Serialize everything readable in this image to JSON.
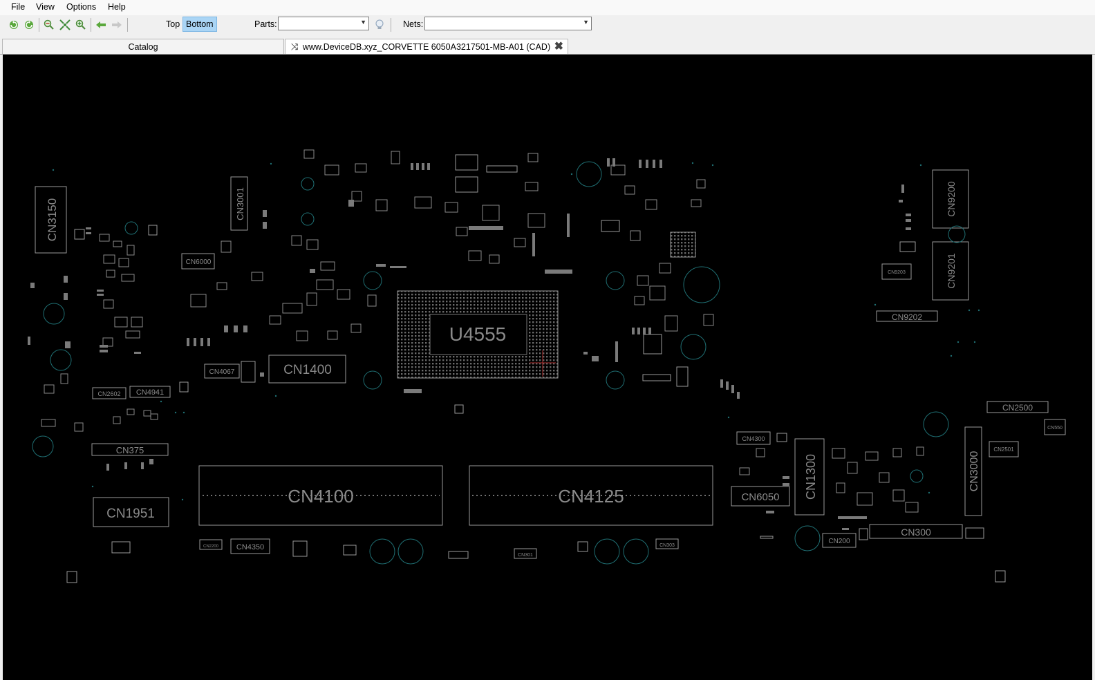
{
  "menubar": {
    "file": "File",
    "view": "View",
    "options": "Options",
    "help": "Help"
  },
  "toolbar": {
    "top_label": "Top",
    "bottom_label": "Bottom",
    "parts_label": "Parts:",
    "parts_value": "",
    "nets_label": "Nets:",
    "nets_value": "",
    "icons": [
      "rotate-left-icon",
      "rotate-right-icon",
      "zoom-out-icon",
      "fit-icon",
      "zoom-in-icon",
      "back-icon",
      "forward-icon",
      "bulb-icon"
    ]
  },
  "tabs": {
    "catalog": "Catalog",
    "cad": "www.DeviceDB.xyz_CORVETTE 6050A3217501-MB-A01 (CAD)"
  },
  "board": {
    "components": {
      "cn3150": "CN3150",
      "cn3001": "CN3001",
      "cn6000": "CN6000",
      "cn1400": "CN1400",
      "cn4067": "CN4067",
      "cn2602": "CN2602",
      "cn4941": "CN4941",
      "cn375": "CN375",
      "cn1951": "CN1951",
      "cn4100": "CN4100",
      "cn4125": "CN4125",
      "cn2200": "CN2200",
      "cn4350": "CN4350",
      "cn301": "CN301",
      "cn303": "CN303",
      "u4555": "U4555",
      "cn9200": "CN9200",
      "cn9201": "CN9201",
      "cn9203": "CN9203",
      "cn9202": "CN9202",
      "cn2500": "CN2500",
      "cn550": "CN550",
      "cn2501": "CN2501",
      "cn4300": "CN4300",
      "cn1300": "CN1300",
      "cn3000": "CN3000",
      "cn6050": "CN6050",
      "cn300": "CN300",
      "cn200": "CN200"
    }
  },
  "colors": {
    "canvas": "#000000",
    "outline": "#9a9a9a",
    "teal": "#1f6f73",
    "toggle_active": "#aad5f5"
  }
}
